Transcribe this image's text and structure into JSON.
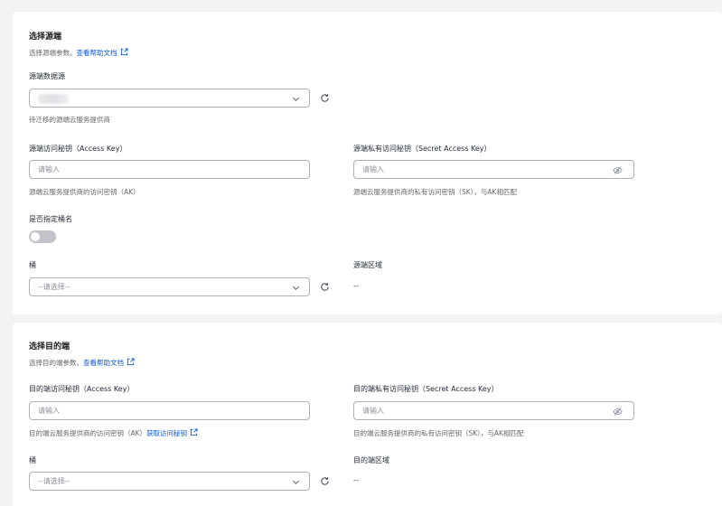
{
  "source": {
    "title": "选择源端",
    "desc_prefix": "选择源端参数。",
    "help_link": "查看帮助文档",
    "datasource_label": "源端数据源",
    "datasource_hint": "待迁移的源端云服务提供商",
    "ak_label": "源端访问秘钥（Access Key）",
    "ak_placeholder": "请输入",
    "ak_hint": "源端云服务提供商的访问密钥（AK）",
    "sk_label": "源端私有访问秘钥（Secret Access Key）",
    "sk_placeholder": "请输入",
    "sk_hint": "源端云服务提供商的私有访问密钥（SK），与AK相匹配",
    "specify_bucket_label": "是否指定桶名",
    "specify_bucket_on": false,
    "bucket_label": "桶",
    "bucket_placeholder": "--请选择--",
    "region_label": "源端区域",
    "region_value": "--"
  },
  "target": {
    "title": "选择目的端",
    "desc_prefix": "选择目的端参数。",
    "help_link": "查看帮助文档",
    "ak_label": "目的端访问秘钥（Access Key）",
    "ak_placeholder": "请输入",
    "ak_hint_prefix": "目的端云服务提供商的访问密钥（AK）",
    "ak_hint_link": "获取访问秘钥",
    "sk_label": "目的端私有访问秘钥（Secret Access Key）",
    "sk_placeholder": "请输入",
    "sk_hint": "目的端云服务提供商的私有访问密钥（SK），与AK相匹配",
    "bucket_label": "桶",
    "bucket_placeholder": "--请选择--",
    "region_label": "目的端区域",
    "region_value": "--"
  },
  "colors": {
    "link": "#0958d9",
    "border": "#adb0b8",
    "switch_off": "#c2c4c9"
  },
  "icons": [
    "external-link-icon",
    "chevron-down-icon",
    "refresh-icon",
    "eye-hidden-icon"
  ]
}
